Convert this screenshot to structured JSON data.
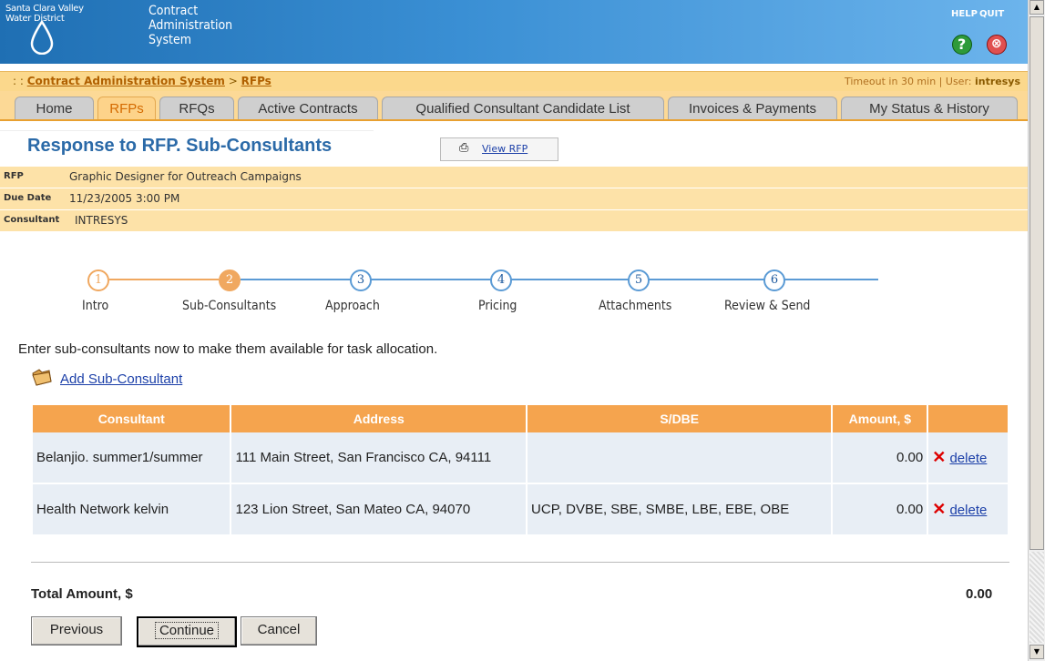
{
  "header": {
    "logo_line1": "Santa Clara Valley",
    "logo_line2": "Water District",
    "app_title_1": "Contract",
    "app_title_2": "Administration",
    "app_title_3": "System",
    "help": "HELP",
    "quit": "QUIT"
  },
  "breadcrumb": {
    "prefix": ": : ",
    "root": "Contract Administration System",
    "sep": " > ",
    "current": "RFPs",
    "timeout": "Timeout in 30 min |",
    "user_label": "User:",
    "user": "intresys"
  },
  "tabs": [
    "Home",
    "RFPs",
    "RFQs",
    "Active Contracts",
    "Qualified Consultant Candidate List",
    "Invoices & Payments",
    "My Status & History"
  ],
  "page": {
    "title": "Response to RFP. Sub-Consultants",
    "view_rfp": "View RFP"
  },
  "info": {
    "rfp_label": "RFP",
    "rfp_value": "Graphic Designer for Outreach Campaigns",
    "due_label": "Due Date",
    "due_value": "11/23/2005 3:00 PM",
    "consultant_label": "Consultant",
    "consultant_value": "INTRESYS"
  },
  "steps": [
    {
      "num": "1",
      "label": "Intro"
    },
    {
      "num": "2",
      "label": "Sub-Consultants"
    },
    {
      "num": "3",
      "label": "Approach"
    },
    {
      "num": "4",
      "label": "Pricing"
    },
    {
      "num": "5",
      "label": "Attachments"
    },
    {
      "num": "6",
      "label": "Review & Send"
    }
  ],
  "instructions": "Enter sub-consultants now to make them available for task allocation.",
  "add_link": "Add Sub-Consultant",
  "table": {
    "headers": [
      "Consultant",
      "Address",
      "S/DBE",
      "Amount, $"
    ],
    "rows": [
      {
        "consultant": "Belanjio. summer1/summer",
        "address": "111 Main Street, San Francisco CA, 94111",
        "sdbe": "",
        "amount": "0.00",
        "action": "delete"
      },
      {
        "consultant": "Health Network kelvin",
        "address": "123 Lion Street, San Mateo CA, 94070",
        "sdbe": "UCP, DVBE, SBE, SMBE, LBE, EBE, OBE",
        "amount": "0.00",
        "action": "delete"
      }
    ]
  },
  "total": {
    "label": "Total Amount, $",
    "value": "0.00"
  },
  "buttons": {
    "previous": "Previous",
    "continue": "Continue",
    "cancel": "Cancel"
  },
  "colors": {
    "accent_orange": "#f5a44e",
    "brand_blue": "#2b6aa8",
    "link": "#1b3fa8"
  }
}
